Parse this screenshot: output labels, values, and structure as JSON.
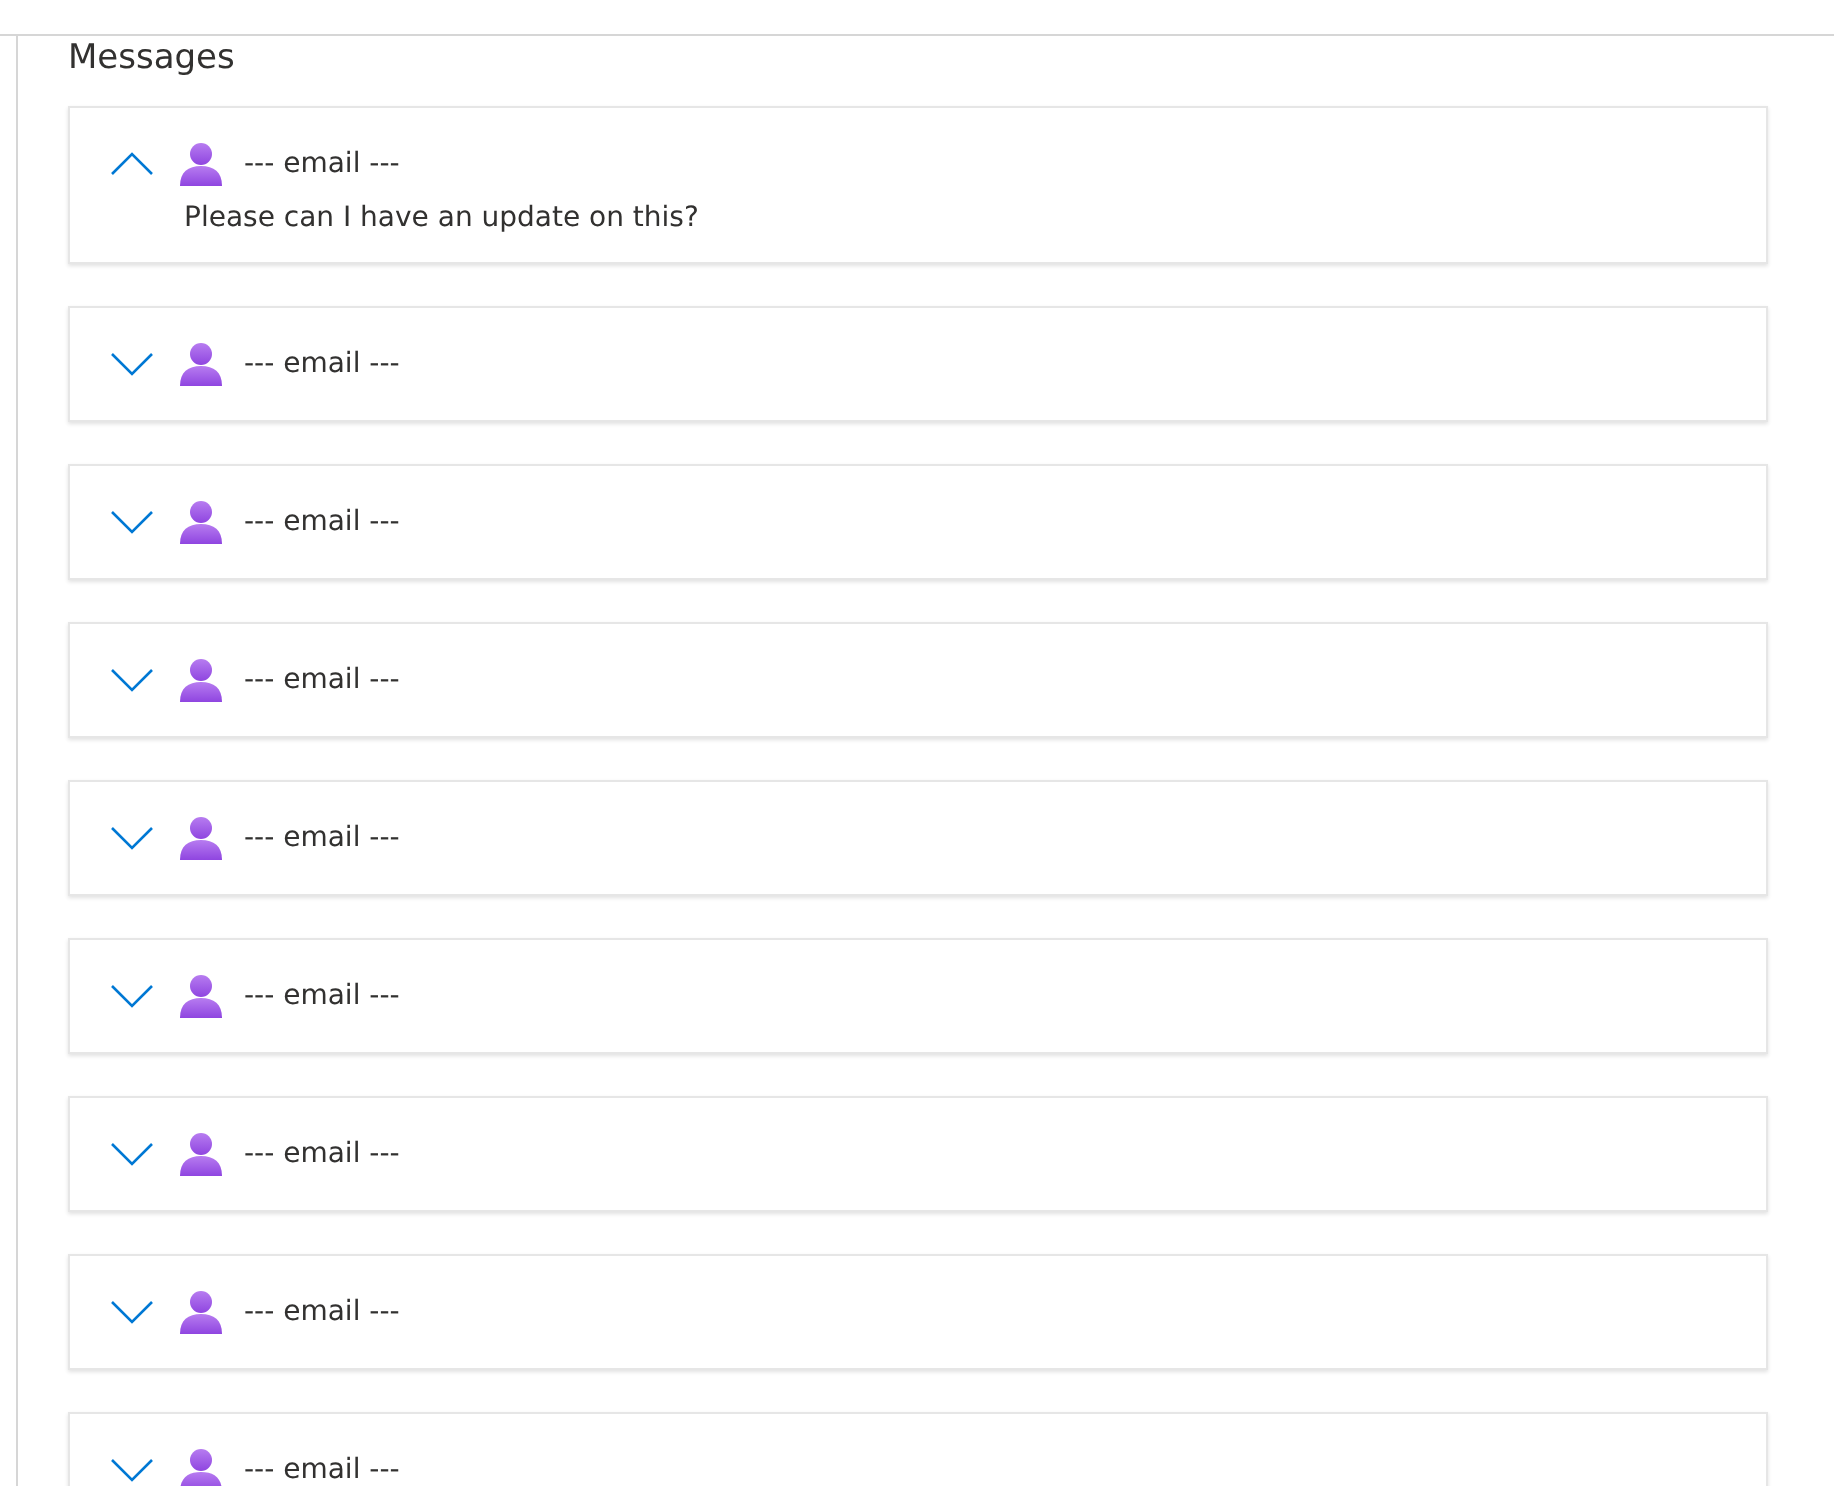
{
  "section": {
    "title": "Messages"
  },
  "messages": [
    {
      "sender": "--- email ---",
      "expanded": true,
      "body": "Please can I have an update on this?"
    },
    {
      "sender": "--- email ---",
      "expanded": false
    },
    {
      "sender": "--- email ---",
      "expanded": false
    },
    {
      "sender": "--- email ---",
      "expanded": false
    },
    {
      "sender": "--- email ---",
      "expanded": false
    },
    {
      "sender": "--- email ---",
      "expanded": false
    },
    {
      "sender": "--- email ---",
      "expanded": false
    },
    {
      "sender": "--- email ---",
      "expanded": false
    },
    {
      "sender": "--- email ---",
      "expanded": false
    }
  ]
}
